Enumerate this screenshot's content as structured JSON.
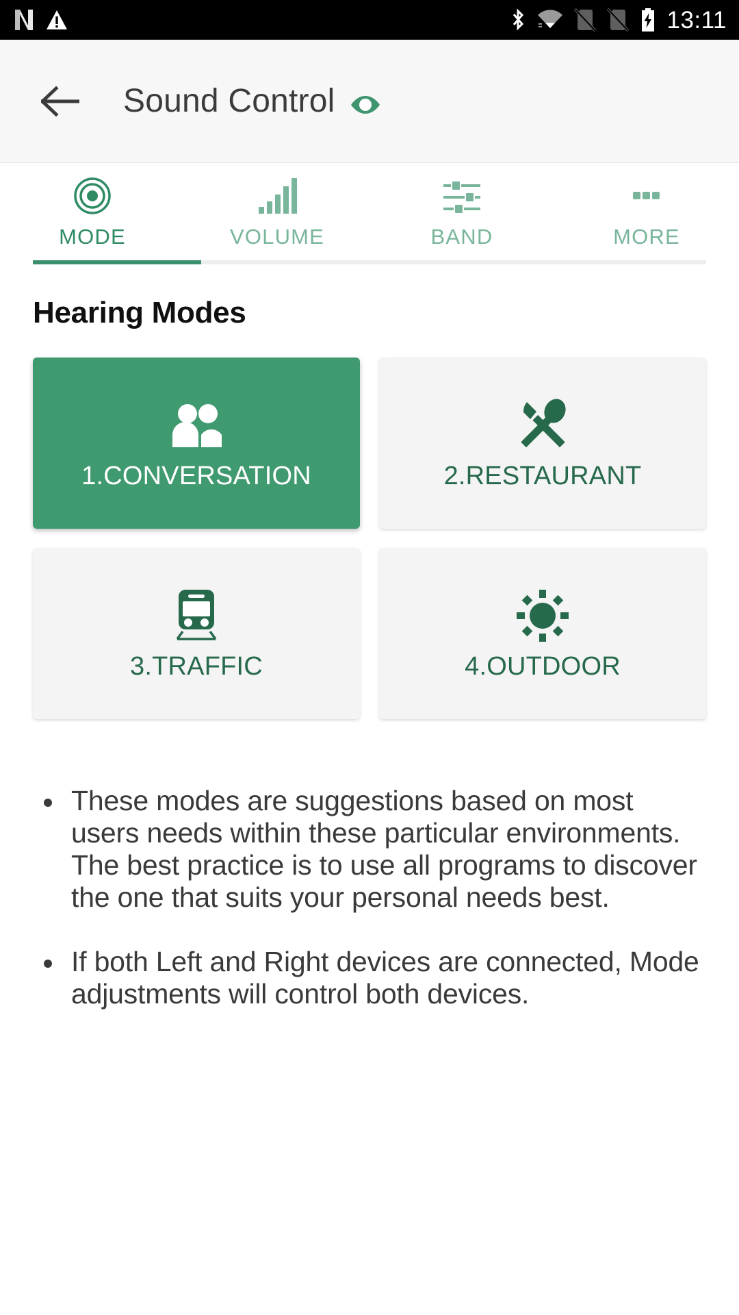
{
  "statusbar": {
    "time": "13:11",
    "left_icons": [
      "netflix-n-icon",
      "warning-triangle-icon"
    ],
    "right_icons": [
      "bluetooth-icon",
      "wifi-icon",
      "sim-card-1-off-icon",
      "sim-card-2-off-icon",
      "battery-charging-icon"
    ]
  },
  "appbar": {
    "back_icon": "arrow-back-icon",
    "title": "Sound Control",
    "eye_icon": "eye-icon"
  },
  "tabs": {
    "active_index": 0,
    "items": [
      {
        "label": "MODE",
        "icon": "target-circles-icon"
      },
      {
        "label": "VOLUME",
        "icon": "signal-bars-icon"
      },
      {
        "label": "BAND",
        "icon": "sliders-icon"
      },
      {
        "label": "MORE",
        "icon": "more-dots-icon"
      }
    ]
  },
  "main": {
    "section_title": "Hearing Modes",
    "modes": [
      {
        "label": "1.CONVERSATION",
        "icon": "people-icon",
        "selected": true
      },
      {
        "label": "2.RESTAURANT",
        "icon": "knife-spoon-icon",
        "selected": false
      },
      {
        "label": "3.TRAFFIC",
        "icon": "train-icon",
        "selected": false
      },
      {
        "label": "4.OUTDOOR",
        "icon": "sun-icon",
        "selected": false
      }
    ],
    "notes": [
      "These modes are suggestions based on most users needs within these particular environments. The best practice is to use all programs to discover the one that suits your personal needs best.",
      "If both Left and Right devices are connected, Mode adjustments will control both devices."
    ]
  },
  "colors": {
    "accent_green": "#409a70",
    "dark_green": "#26694b",
    "tab_active": "#2e8b63",
    "tab_inactive": "#79b59a",
    "card_bg": "#f4f4f4",
    "appbar_bg": "#f7f7f7",
    "statusbar_bg": "#000000"
  }
}
